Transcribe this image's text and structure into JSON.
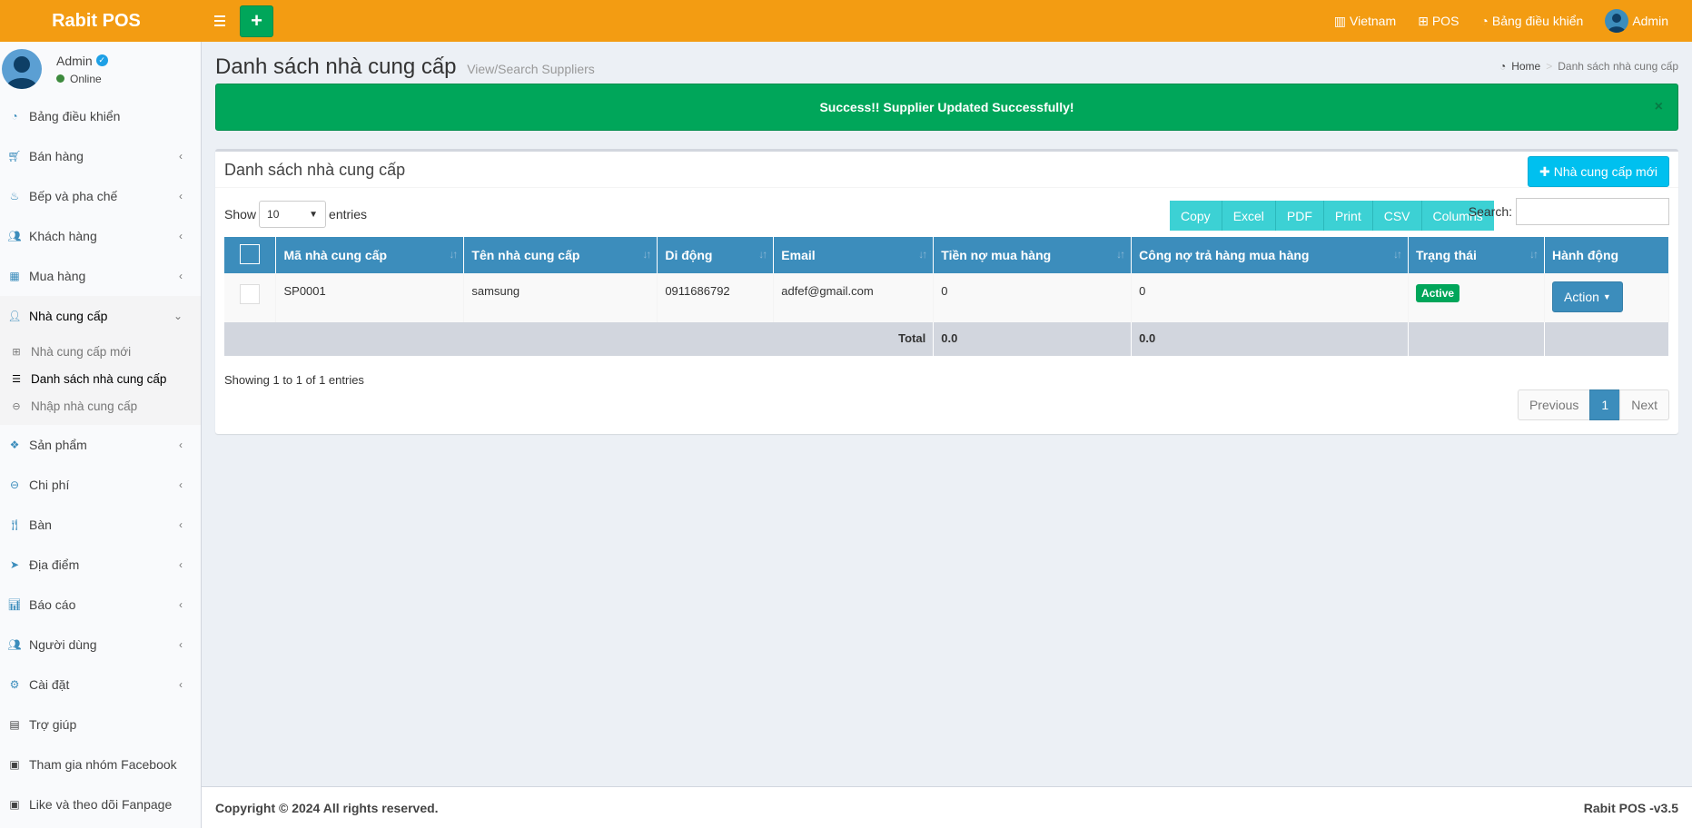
{
  "app": {
    "name": "Rabit POS"
  },
  "topnav": {
    "language": "Vietnam",
    "pos": "POS",
    "dashboard": "Bảng điều khiển",
    "user": "Admin"
  },
  "user": {
    "name": "Admin",
    "status": "Online"
  },
  "sidebar": {
    "items": [
      {
        "label": "Bảng điều khiển",
        "icon": "dashboard-icon"
      },
      {
        "label": "Bán hàng",
        "icon": "cart-icon"
      },
      {
        "label": "Bếp và pha chế",
        "icon": "kitchen-icon"
      },
      {
        "label": "Khách hàng",
        "icon": "users-icon"
      },
      {
        "label": "Mua hàng",
        "icon": "grid-icon"
      },
      {
        "label": "Nhà cung cấp",
        "icon": "user-plus-icon"
      },
      {
        "label": "Sản phẩm",
        "icon": "cubes-icon"
      },
      {
        "label": "Chi phí",
        "icon": "minus-circle-icon"
      },
      {
        "label": "Bàn",
        "icon": "cutlery-icon"
      },
      {
        "label": "Địa điểm",
        "icon": "paper-plane-icon"
      },
      {
        "label": "Báo cáo",
        "icon": "bar-chart-icon"
      },
      {
        "label": "Người dùng",
        "icon": "users-icon"
      },
      {
        "label": "Cài đặt",
        "icon": "cogs-icon"
      },
      {
        "label": "Trợ giúp",
        "icon": "book-icon"
      },
      {
        "label": "Tham gia nhóm Facebook",
        "icon": "briefcase-icon"
      },
      {
        "label": "Like và theo dõi Fanpage",
        "icon": "briefcase-icon"
      }
    ],
    "submenu": [
      {
        "label": "Nhà cung cấp mới",
        "icon": "plus-square-icon"
      },
      {
        "label": "Danh sách nhà cung cấp",
        "icon": "list-icon"
      },
      {
        "label": "Nhập nhà cung cấp",
        "icon": "import-icon"
      }
    ]
  },
  "header": {
    "title": "Danh sách nhà cung cấp",
    "subtitle": "View/Search Suppliers",
    "breadcrumb_home": "Home",
    "breadcrumb_current": "Danh sách nhà cung cấp"
  },
  "alert": {
    "message": "Success!! Supplier Updated Successfully!",
    "close": "×",
    "color": "#00a65a"
  },
  "box": {
    "title": "Danh sách nhà cung cấp",
    "new_button": "Nhà cung cấp mới",
    "show_label": "Show",
    "entries_label": "entries",
    "page_length": "10",
    "search_label": "Search:",
    "export_buttons": [
      "Copy",
      "Excel",
      "PDF",
      "Print",
      "CSV",
      "Columns"
    ]
  },
  "table": {
    "columns": [
      "Mã nhà cung cấp",
      "Tên nhà cung cấp",
      "Di động",
      "Email",
      "Tiền nợ mua hàng",
      "Công nợ trả hàng mua hàng",
      "Trạng thái",
      "Hành động"
    ],
    "rows": [
      {
        "code": "SP0001",
        "name": "samsung",
        "mobile": "0911686792",
        "email": "adfef@gmail.com",
        "debt": "0",
        "return_debt": "0",
        "status": "Active",
        "action": "Action"
      }
    ],
    "total_label": "Total",
    "total_debt": "0.0",
    "total_return_debt": "0.0"
  },
  "pagination": {
    "info": "Showing 1 to 1 of 1 entries",
    "previous": "Previous",
    "current": "1",
    "next": "Next"
  },
  "footer": {
    "copyright": "Copyright © 2024 All rights reserved.",
    "version": "Rabit POS -v3.5"
  },
  "colors": {
    "topbar": "#f39c12",
    "primary": "#3c8dbc",
    "success": "#00a65a",
    "info": "#00c0ef",
    "dt_button": "#3cd1d4"
  }
}
